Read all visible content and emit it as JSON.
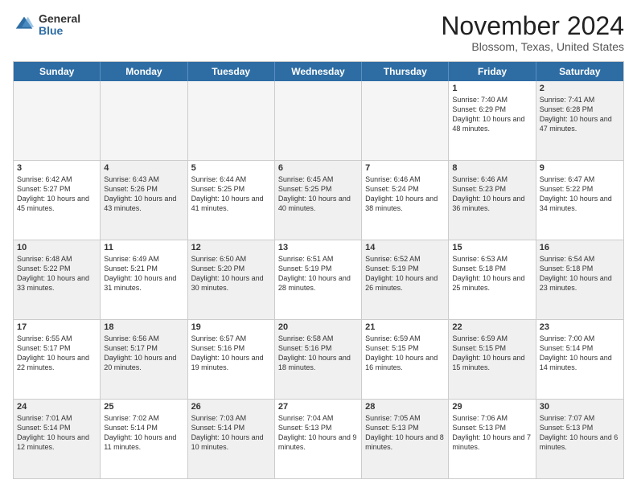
{
  "header": {
    "logo_line1": "General",
    "logo_line2": "Blue",
    "month_title": "November 2024",
    "location": "Blossom, Texas, United States"
  },
  "weekdays": [
    "Sunday",
    "Monday",
    "Tuesday",
    "Wednesday",
    "Thursday",
    "Friday",
    "Saturday"
  ],
  "rows": [
    [
      {
        "day": "",
        "text": "",
        "empty": true
      },
      {
        "day": "",
        "text": "",
        "empty": true
      },
      {
        "day": "",
        "text": "",
        "empty": true
      },
      {
        "day": "",
        "text": "",
        "empty": true
      },
      {
        "day": "",
        "text": "",
        "empty": true
      },
      {
        "day": "1",
        "text": "Sunrise: 7:40 AM\nSunset: 6:29 PM\nDaylight: 10 hours and 48 minutes.",
        "empty": false
      },
      {
        "day": "2",
        "text": "Sunrise: 7:41 AM\nSunset: 6:28 PM\nDaylight: 10 hours and 47 minutes.",
        "empty": false,
        "shaded": true
      }
    ],
    [
      {
        "day": "3",
        "text": "Sunrise: 6:42 AM\nSunset: 5:27 PM\nDaylight: 10 hours and 45 minutes.",
        "empty": false
      },
      {
        "day": "4",
        "text": "Sunrise: 6:43 AM\nSunset: 5:26 PM\nDaylight: 10 hours and 43 minutes.",
        "empty": false,
        "shaded": true
      },
      {
        "day": "5",
        "text": "Sunrise: 6:44 AM\nSunset: 5:25 PM\nDaylight: 10 hours and 41 minutes.",
        "empty": false
      },
      {
        "day": "6",
        "text": "Sunrise: 6:45 AM\nSunset: 5:25 PM\nDaylight: 10 hours and 40 minutes.",
        "empty": false,
        "shaded": true
      },
      {
        "day": "7",
        "text": "Sunrise: 6:46 AM\nSunset: 5:24 PM\nDaylight: 10 hours and 38 minutes.",
        "empty": false
      },
      {
        "day": "8",
        "text": "Sunrise: 6:46 AM\nSunset: 5:23 PM\nDaylight: 10 hours and 36 minutes.",
        "empty": false,
        "shaded": true
      },
      {
        "day": "9",
        "text": "Sunrise: 6:47 AM\nSunset: 5:22 PM\nDaylight: 10 hours and 34 minutes.",
        "empty": false
      }
    ],
    [
      {
        "day": "10",
        "text": "Sunrise: 6:48 AM\nSunset: 5:22 PM\nDaylight: 10 hours and 33 minutes.",
        "empty": false,
        "shaded": true
      },
      {
        "day": "11",
        "text": "Sunrise: 6:49 AM\nSunset: 5:21 PM\nDaylight: 10 hours and 31 minutes.",
        "empty": false
      },
      {
        "day": "12",
        "text": "Sunrise: 6:50 AM\nSunset: 5:20 PM\nDaylight: 10 hours and 30 minutes.",
        "empty": false,
        "shaded": true
      },
      {
        "day": "13",
        "text": "Sunrise: 6:51 AM\nSunset: 5:19 PM\nDaylight: 10 hours and 28 minutes.",
        "empty": false
      },
      {
        "day": "14",
        "text": "Sunrise: 6:52 AM\nSunset: 5:19 PM\nDaylight: 10 hours and 26 minutes.",
        "empty": false,
        "shaded": true
      },
      {
        "day": "15",
        "text": "Sunrise: 6:53 AM\nSunset: 5:18 PM\nDaylight: 10 hours and 25 minutes.",
        "empty": false
      },
      {
        "day": "16",
        "text": "Sunrise: 6:54 AM\nSunset: 5:18 PM\nDaylight: 10 hours and 23 minutes.",
        "empty": false,
        "shaded": true
      }
    ],
    [
      {
        "day": "17",
        "text": "Sunrise: 6:55 AM\nSunset: 5:17 PM\nDaylight: 10 hours and 22 minutes.",
        "empty": false
      },
      {
        "day": "18",
        "text": "Sunrise: 6:56 AM\nSunset: 5:17 PM\nDaylight: 10 hours and 20 minutes.",
        "empty": false,
        "shaded": true
      },
      {
        "day": "19",
        "text": "Sunrise: 6:57 AM\nSunset: 5:16 PM\nDaylight: 10 hours and 19 minutes.",
        "empty": false
      },
      {
        "day": "20",
        "text": "Sunrise: 6:58 AM\nSunset: 5:16 PM\nDaylight: 10 hours and 18 minutes.",
        "empty": false,
        "shaded": true
      },
      {
        "day": "21",
        "text": "Sunrise: 6:59 AM\nSunset: 5:15 PM\nDaylight: 10 hours and 16 minutes.",
        "empty": false
      },
      {
        "day": "22",
        "text": "Sunrise: 6:59 AM\nSunset: 5:15 PM\nDaylight: 10 hours and 15 minutes.",
        "empty": false,
        "shaded": true
      },
      {
        "day": "23",
        "text": "Sunrise: 7:00 AM\nSunset: 5:14 PM\nDaylight: 10 hours and 14 minutes.",
        "empty": false
      }
    ],
    [
      {
        "day": "24",
        "text": "Sunrise: 7:01 AM\nSunset: 5:14 PM\nDaylight: 10 hours and 12 minutes.",
        "empty": false,
        "shaded": true
      },
      {
        "day": "25",
        "text": "Sunrise: 7:02 AM\nSunset: 5:14 PM\nDaylight: 10 hours and 11 minutes.",
        "empty": false
      },
      {
        "day": "26",
        "text": "Sunrise: 7:03 AM\nSunset: 5:14 PM\nDaylight: 10 hours and 10 minutes.",
        "empty": false,
        "shaded": true
      },
      {
        "day": "27",
        "text": "Sunrise: 7:04 AM\nSunset: 5:13 PM\nDaylight: 10 hours and 9 minutes.",
        "empty": false
      },
      {
        "day": "28",
        "text": "Sunrise: 7:05 AM\nSunset: 5:13 PM\nDaylight: 10 hours and 8 minutes.",
        "empty": false,
        "shaded": true
      },
      {
        "day": "29",
        "text": "Sunrise: 7:06 AM\nSunset: 5:13 PM\nDaylight: 10 hours and 7 minutes.",
        "empty": false
      },
      {
        "day": "30",
        "text": "Sunrise: 7:07 AM\nSunset: 5:13 PM\nDaylight: 10 hours and 6 minutes.",
        "empty": false,
        "shaded": true
      }
    ]
  ]
}
